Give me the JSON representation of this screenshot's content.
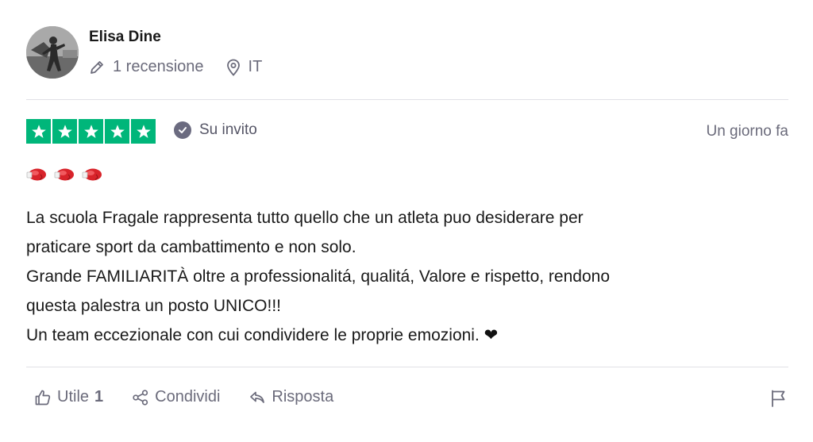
{
  "reviewer": {
    "name": "Elisa Dine",
    "review_count": "1 recensione",
    "country": "IT"
  },
  "rating": {
    "stars": 5,
    "max_stars": 5,
    "star_color": "#00b67a",
    "verified_label": "Su invito",
    "date": "Un giorno fa"
  },
  "review": {
    "emojis": [
      "boxing-glove",
      "boxing-glove",
      "boxing-glove"
    ],
    "lines": [
      "La scuola Fragale rappresenta tutto quello che un atleta puo desiderare per",
      "praticare sport da cambattimento e non solo.",
      "Grande FAMILIARITÀ oltre a professionalitá, qualitá, Valore e rispetto, rendono",
      "questa palestra un posto UNICO!!!",
      "Un team eccezionale con cui condividere le proprie emozioni."
    ],
    "last_line_emoji": "❤"
  },
  "actions": {
    "useful_label": "Utile",
    "useful_count": "1",
    "share_label": "Condividi",
    "reply_label": "Risposta"
  }
}
